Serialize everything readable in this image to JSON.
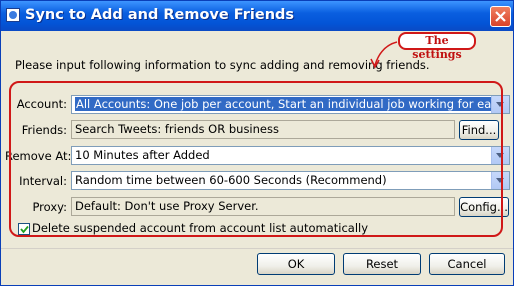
{
  "window": {
    "title": "Sync to Add and Remove Friends"
  },
  "intro": "Please input following information to sync adding and removing friends.",
  "annotation": "The settings",
  "form": {
    "account": {
      "label": "Account:",
      "value": "All Accounts: One job per account, Start an individual job working for each account"
    },
    "friends": {
      "label": "Friends:",
      "value": "Search Tweets: friends OR business",
      "button": "Find..."
    },
    "remove_at": {
      "label": "Remove At:",
      "value": "10 Minutes after Added"
    },
    "interval": {
      "label": "Interval:",
      "value": "Random time between 60-600 Seconds (Recommend)"
    },
    "proxy": {
      "label": "Proxy:",
      "value": "Default: Don't use Proxy Server.",
      "button": "Config..."
    },
    "delete_suspended": {
      "label": "Delete suspended account from account list automatically",
      "checked": true
    }
  },
  "buttons": {
    "ok": "OK",
    "reset": "Reset",
    "cancel": "Cancel"
  },
  "colors": {
    "titlebar": "#0a5fe0",
    "highlight": "#d01818",
    "selection": "#316ac5"
  }
}
